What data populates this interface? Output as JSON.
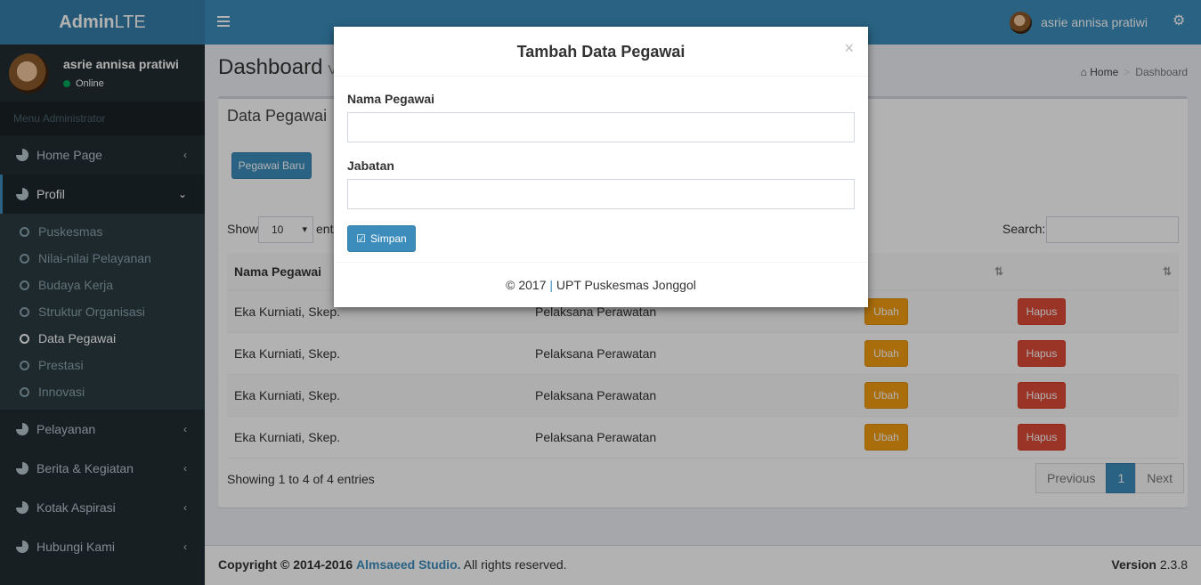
{
  "header": {
    "logo_bold": "Admin",
    "logo_light": "LTE",
    "user_name": "asrie annisa pratiwi"
  },
  "sidebar": {
    "user_name": "asrie annisa pratiwi",
    "status": "Online",
    "menu_header": "Menu Administrator",
    "items": [
      {
        "label": "Home Page"
      },
      {
        "label": "Profil"
      },
      {
        "label": "Pelayanan"
      },
      {
        "label": "Berita & Kegiatan"
      },
      {
        "label": "Kotak Aspirasi"
      },
      {
        "label": "Hubungi Kami"
      }
    ],
    "submenu": [
      {
        "label": "Puskesmas"
      },
      {
        "label": "Nilai-nilai Pelayanan"
      },
      {
        "label": "Budaya Kerja"
      },
      {
        "label": "Struktur Organisasi"
      },
      {
        "label": "Data Pegawai"
      },
      {
        "label": "Prestasi"
      },
      {
        "label": "Innovasi"
      }
    ]
  },
  "page": {
    "title": "Dashboard",
    "subtitle": "Ve",
    "breadcrumb_home": "Home",
    "breadcrumb_current": "Dashboard"
  },
  "box": {
    "title": "Data Pegawai",
    "new_button": "Pegawai Baru",
    "show_label": "Show",
    "entries_value": "10",
    "entries_suffix": "ent",
    "search_label": "Search:",
    "columns": [
      "Nama Pegawai",
      "",
      "",
      ""
    ],
    "rows": [
      {
        "nama": "Eka Kurniati, Skep.",
        "jabatan": "Pelaksana Perawatan"
      },
      {
        "nama": "Eka Kurniati, Skep.",
        "jabatan": "Pelaksana Perawatan"
      },
      {
        "nama": "Eka Kurniati, Skep.",
        "jabatan": "Pelaksana Perawatan"
      },
      {
        "nama": "Eka Kurniati, Skep.",
        "jabatan": "Pelaksana Perawatan"
      }
    ],
    "edit_label": "Ubah",
    "delete_label": "Hapus",
    "info": "Showing 1 to 4 of 4 entries",
    "pager": {
      "previous": "Previous",
      "page": "1",
      "next": "Next"
    }
  },
  "footer": {
    "copyright": "Copyright © 2014-2016",
    "studio": "Almsaeed Studio.",
    "rights": "All rights reserved.",
    "version_label": "Version",
    "version_value": "2.3.8"
  },
  "modal": {
    "title": "Tambah Data Pegawai",
    "close": "×",
    "field1_label": "Nama Pegawai",
    "field2_label": "Jabatan",
    "save_label": "Simpan",
    "footer_left": "© 2017",
    "footer_sep": "|",
    "footer_right": "UPT Puskesmas Jonggol"
  }
}
